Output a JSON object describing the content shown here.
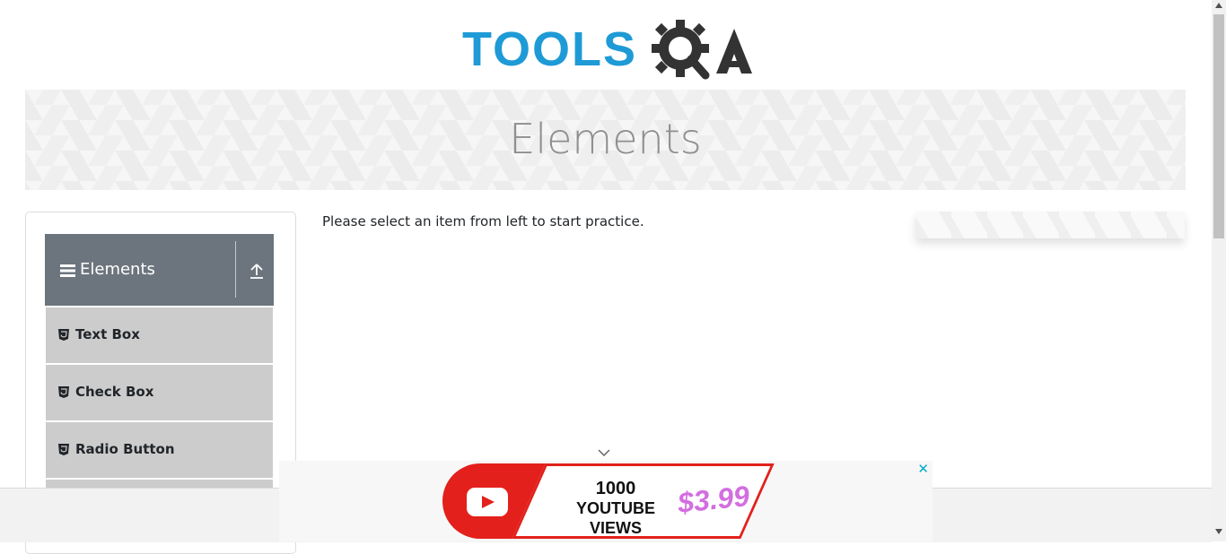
{
  "logo": {
    "text_main": "TOOLS",
    "text_qa": "QA"
  },
  "banner": {
    "title": "Elements"
  },
  "sidebar": {
    "group_title": "Elements",
    "items": [
      {
        "label": "Text Box"
      },
      {
        "label": "Check Box"
      },
      {
        "label": "Radio Button"
      }
    ]
  },
  "main": {
    "instruction": "Please select an item from left to start practice."
  },
  "ad": {
    "close": "✕",
    "line1": "1000",
    "line2": "YOUTUBE VIEWS",
    "price": "$3.99"
  },
  "colors": {
    "brand_blue": "#1e9ad6",
    "group_header": "#6c757d",
    "menu_item": "#cccccc",
    "ad_red": "#e3201b"
  },
  "icons": {
    "hamburger": "bars-icon",
    "collapse": "upload-arrow-icon",
    "item": "html5-icon",
    "ad_collapse": "chevron-down-icon"
  }
}
